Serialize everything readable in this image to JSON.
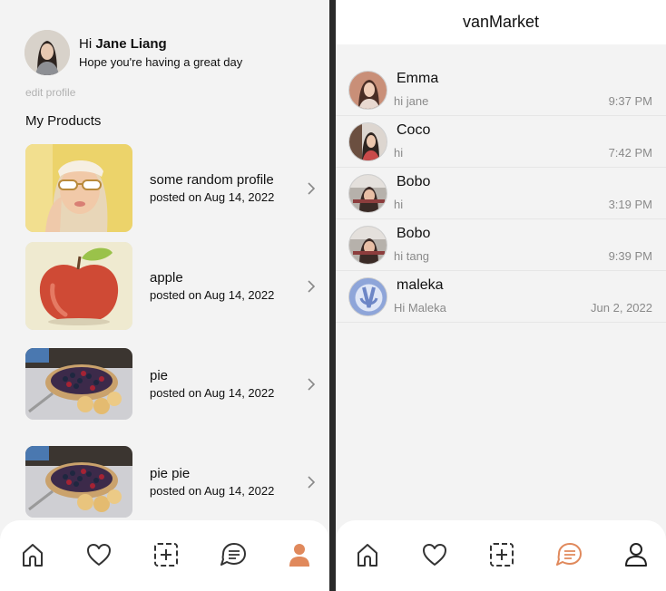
{
  "profile": {
    "greeting": "Hi",
    "user_name": "Jane Liang",
    "tagline": "Hope you're having a great day",
    "edit_label": "edit profile",
    "section_title": "My Products"
  },
  "products": [
    {
      "name": "some random profile",
      "date": "posted on Aug 14, 2022",
      "image": "woman-sunglasses"
    },
    {
      "name": "apple",
      "date": "posted on Aug 14, 2022",
      "image": "apple"
    },
    {
      "name": "pie",
      "date": "posted on Aug 14, 2022",
      "image": "berry-pie"
    },
    {
      "name": "pie pie",
      "date": "posted on Aug 14, 2022",
      "image": "berry-pie"
    }
  ],
  "chat": {
    "title": "vanMarket",
    "conversations": [
      {
        "name": "Emma",
        "message": "hi jane",
        "time": "9:37 PM"
      },
      {
        "name": "Coco",
        "message": "hi",
        "time": "7:42 PM"
      },
      {
        "name": "Bobo",
        "message": "hi",
        "time": "3:19 PM"
      },
      {
        "name": "Bobo",
        "message": "hi tang",
        "time": "9:39 PM"
      },
      {
        "name": "maleka",
        "message": "Hi Maleka",
        "time": "Jun 2, 2022"
      }
    ]
  },
  "tabs": [
    "home-icon",
    "heart-icon",
    "add-post-icon",
    "chat-icon",
    "profile-icon"
  ],
  "colors": {
    "accent": "#e0895c",
    "icon": "#333333"
  },
  "active_tab": {
    "left_panel": "profile-icon",
    "right_panel": "chat-icon"
  }
}
